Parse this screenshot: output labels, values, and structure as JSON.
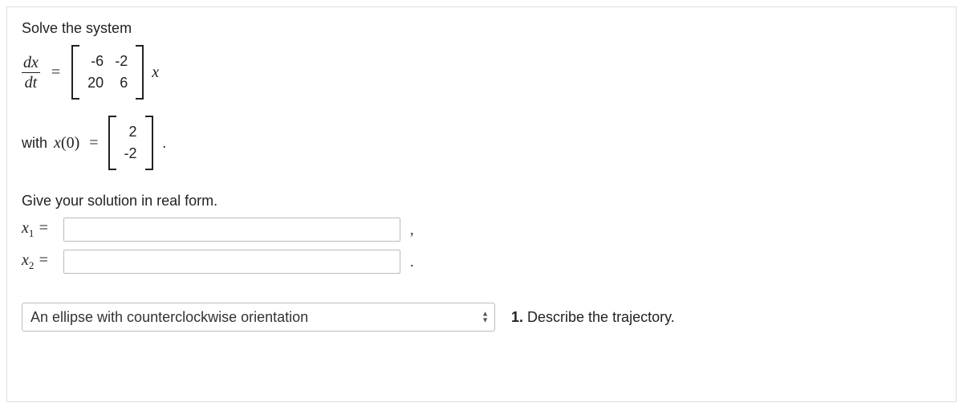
{
  "prompt": "Solve the system",
  "equation": {
    "lhs_num": "dx",
    "lhs_den": "dt",
    "equals": "=",
    "matrix": {
      "a11": "-6",
      "a12": "-2",
      "a21": "20",
      "a22": "6"
    },
    "rhs_var": "x"
  },
  "initial": {
    "with_label": "with ",
    "x_label": "x",
    "zero_arg": "(0)",
    "equals": "=",
    "vector": {
      "v1": "2",
      "v2": "-2"
    },
    "period": "."
  },
  "instruction": "Give your solution in real form.",
  "answers": {
    "x1_label": "x",
    "x1_sub": "1",
    "x1_eq": " =",
    "x1_value": "",
    "x1_trail": ",",
    "x2_label": "x",
    "x2_sub": "2",
    "x2_eq": " =",
    "x2_value": "",
    "x2_trail": "."
  },
  "trajectory": {
    "selected": "An ellipse with counterclockwise orientation",
    "question_num": "1.",
    "question_text": " Describe the trajectory."
  }
}
